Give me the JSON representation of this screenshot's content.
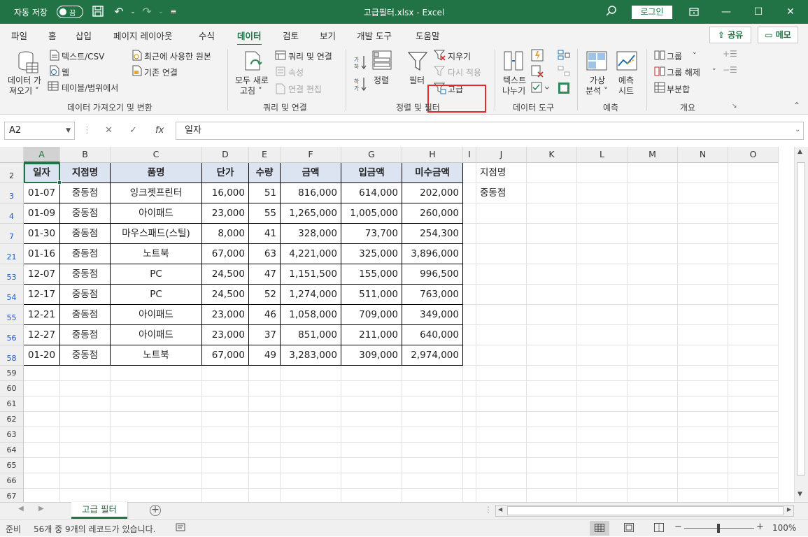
{
  "titlebar": {
    "autosave_label": "자동 저장",
    "autosave_state": "끔",
    "doc_title": "고급필터.xlsx  -  Excel",
    "login_label": "로그인"
  },
  "tabs": [
    "파일",
    "홈",
    "삽입",
    "페이지 레이아웃",
    "수식",
    "데이터",
    "검토",
    "보기",
    "개발 도구",
    "도움말"
  ],
  "active_tab": "데이터",
  "share_label": "공유",
  "memo_label": "메모",
  "ribbon": {
    "get_data": {
      "get_data_btn": [
        "데이터 가",
        "져오기 ˅"
      ],
      "text_csv": "텍스트/CSV",
      "web": "웹",
      "table_range": "테이블/범위에서",
      "recent_sources": "최근에 사용한 원본",
      "existing_connections": "기존 연결",
      "group_label": "데이터 가져오기 및 변환"
    },
    "queries": {
      "refresh_all": [
        "모두 새로",
        "고침 ˅"
      ],
      "queries_connections": "쿼리 및 연결",
      "properties": "속성",
      "edit_links": "연결 편집",
      "group_label": "쿼리 및 연결"
    },
    "sort_filter": {
      "sort": "정렬",
      "filter": "필터",
      "clear": "지우기",
      "reapply": "다시 적용",
      "advanced": "고급",
      "group_label": "정렬 및 필터"
    },
    "data_tools": {
      "text_to_columns": [
        "텍스트",
        "나누기"
      ],
      "group_label": "데이터 도구"
    },
    "forecast": {
      "what_if": [
        "가상",
        "분석 ˅"
      ],
      "forecast_sheet": [
        "예측",
        "시트"
      ],
      "group_label": "예측"
    },
    "outline": {
      "group": "그룹",
      "ungroup": "그룹 해제",
      "subtotal": "부분합",
      "group_label": "개요"
    }
  },
  "formula_bar": {
    "name_box": "A2",
    "formula": "일자"
  },
  "columns": [
    "A",
    "B",
    "C",
    "D",
    "E",
    "F",
    "G",
    "H",
    "I",
    "J",
    "K",
    "L",
    "M",
    "N",
    "O"
  ],
  "selected_column": "A",
  "table": {
    "header_row": "2",
    "headers": [
      "일자",
      "지점명",
      "품명",
      "단가",
      "수량",
      "금액",
      "입금액",
      "미수금액"
    ],
    "rows": [
      {
        "row": "3",
        "cells": [
          "01-07",
          "중동점",
          "잉크젯프린터",
          "16,000",
          "51",
          "816,000",
          "614,000",
          "202,000"
        ]
      },
      {
        "row": "4",
        "cells": [
          "01-09",
          "중동점",
          "아이패드",
          "23,000",
          "55",
          "1,265,000",
          "1,005,000",
          "260,000"
        ]
      },
      {
        "row": "7",
        "cells": [
          "01-30",
          "중동점",
          "마우스패드(스틸)",
          "8,000",
          "41",
          "328,000",
          "73,700",
          "254,300"
        ]
      },
      {
        "row": "21",
        "cells": [
          "01-16",
          "중동점",
          "노트북",
          "67,000",
          "63",
          "4,221,000",
          "325,000",
          "3,896,000"
        ]
      },
      {
        "row": "53",
        "cells": [
          "12-07",
          "중동점",
          "PC",
          "24,500",
          "47",
          "1,151,500",
          "155,000",
          "996,500"
        ]
      },
      {
        "row": "54",
        "cells": [
          "12-17",
          "중동점",
          "PC",
          "24,500",
          "52",
          "1,274,000",
          "511,000",
          "763,000"
        ]
      },
      {
        "row": "55",
        "cells": [
          "12-21",
          "중동점",
          "아이패드",
          "23,000",
          "46",
          "1,058,000",
          "709,000",
          "349,000"
        ]
      },
      {
        "row": "56",
        "cells": [
          "12-27",
          "중동점",
          "아이패드",
          "23,000",
          "37",
          "851,000",
          "211,000",
          "640,000"
        ]
      },
      {
        "row": "58",
        "cells": [
          "01-20",
          "중동점",
          "노트북",
          "67,000",
          "49",
          "3,283,000",
          "309,000",
          "2,974,000"
        ]
      }
    ],
    "blank_rows": [
      "59",
      "60",
      "61",
      "62",
      "63",
      "64",
      "65",
      "66",
      "67"
    ]
  },
  "criteria": {
    "header": "지점명",
    "value": "중동점"
  },
  "sheet_tab": "고급 필터",
  "status": {
    "ready": "준비",
    "message": "56개 중 9개의 레코드가 있습니다.",
    "zoom": "100%"
  },
  "colors": {
    "excel_green": "#217346",
    "header_fill": "#dce4f2",
    "filtered_row_number": "#1a56c7",
    "highlight_box": "#e8282a"
  }
}
